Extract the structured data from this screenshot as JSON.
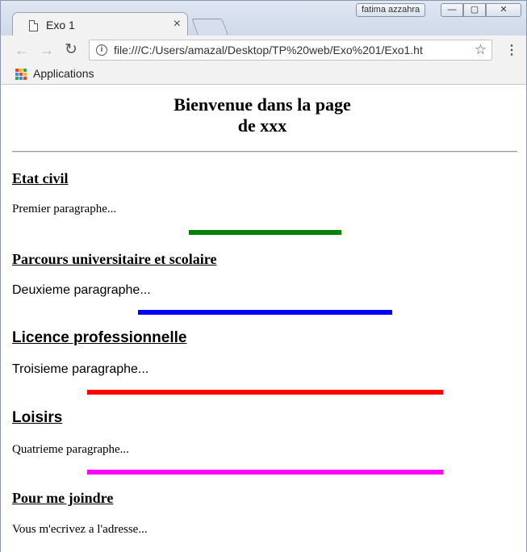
{
  "browser": {
    "tab_title": "Exo 1",
    "tab_close": "×",
    "user_name": "fatima azzahra",
    "window_controls": {
      "minimize": "—",
      "maximize": "▢",
      "close": "✕"
    },
    "url": "file:///C:/Users/amazal/Desktop/TP%20web/Exo%201/Exo1.ht",
    "info_glyph": "i",
    "bookmarks": {
      "apps_label": "Applications"
    },
    "icons": {
      "back": "arrow-left-icon",
      "forward": "arrow-right-icon",
      "reload": "reload-icon",
      "star": "star-icon",
      "menu": "kebab-menu-icon",
      "apps": "apps-grid-icon"
    },
    "glyphs": {
      "back": "←",
      "forward": "→",
      "reload": "↻",
      "star": "☆",
      "menu": "⋮"
    }
  },
  "page": {
    "title_line1": "Bienvenue dans la page",
    "title_line2": "de xxx",
    "sections": [
      {
        "heading": "Etat civil",
        "paragraph": "Premier paragraphe...",
        "bar_color": "#008000"
      },
      {
        "heading": "Parcours universitaire et scolaire",
        "paragraph": "Deuxieme paragraphe...",
        "bar_color": "#0000ff"
      },
      {
        "heading": "Licence professionnelle",
        "paragraph": "Troisieme paragraphe...",
        "bar_color": "#ff0000"
      },
      {
        "heading": "Loisirs",
        "paragraph": "Quatrieme paragraphe...",
        "bar_color": "#ff00ff"
      },
      {
        "heading": "Pour me joindre",
        "paragraph": "Vous m'ecrivez a l'adresse..."
      }
    ]
  }
}
